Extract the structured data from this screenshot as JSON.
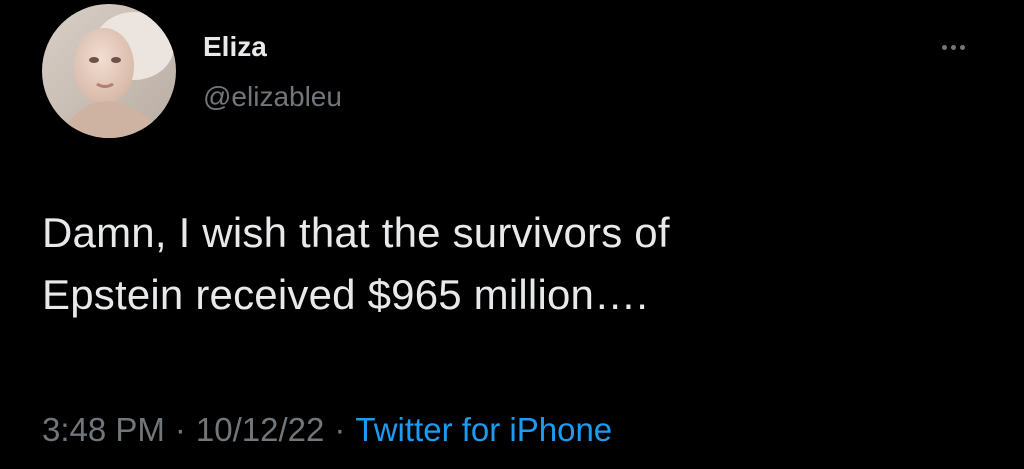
{
  "author": {
    "display_name": "Eliza",
    "handle": "@elizableu",
    "avatar_icon": "profile-photo"
  },
  "more_icon": "more-dots-icon",
  "tweet": {
    "text_lines": [
      "Damn, I wish that the survivors of",
      "Epstein received $965 million…."
    ]
  },
  "meta": {
    "time": "3:48 PM",
    "date": "10/12/22",
    "separator": "·",
    "source": "Twitter for iPhone"
  },
  "colors": {
    "background": "#000000",
    "primary_text": "#e7e9ea",
    "secondary_text": "#71767b",
    "accent": "#1d9bf0"
  }
}
